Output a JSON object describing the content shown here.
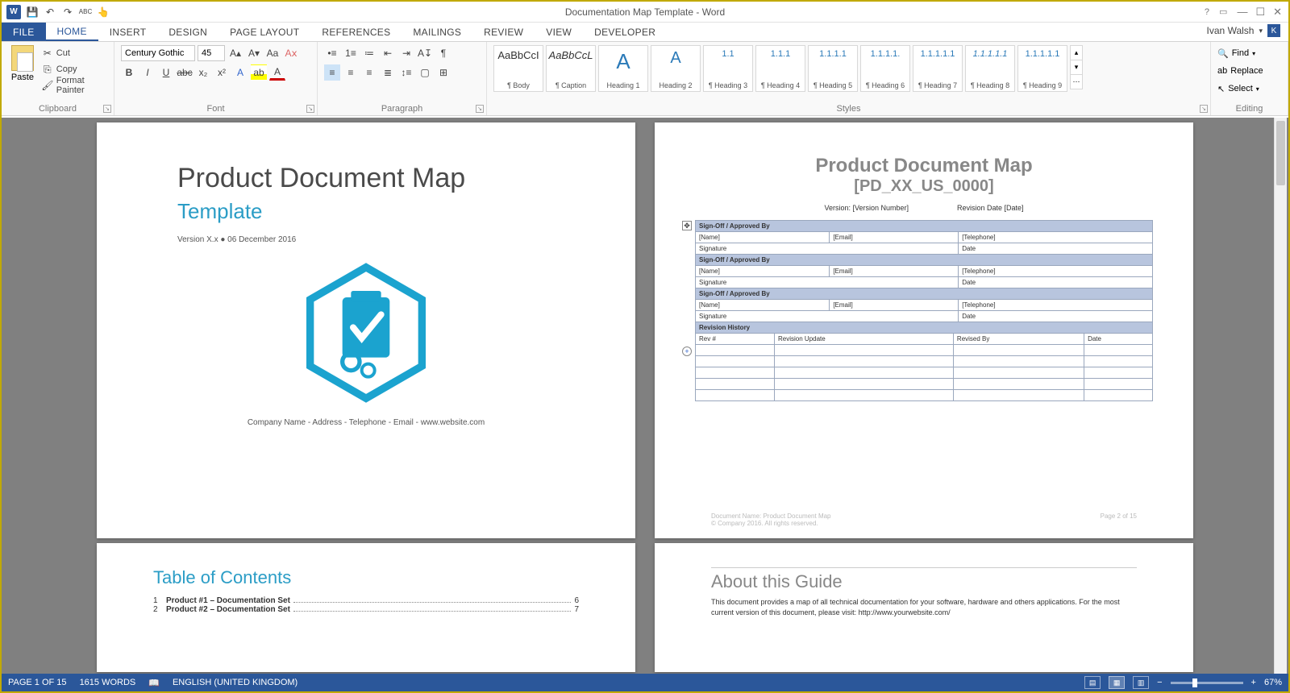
{
  "app": {
    "title": "Documentation Map Template - Word",
    "user": "Ivan Walsh",
    "user_initial": "K"
  },
  "qat": {
    "save": "💾",
    "undo": "↶",
    "redo": "↷",
    "spell": "ABC",
    "touch": "👆"
  },
  "tabs": [
    "FILE",
    "HOME",
    "INSERT",
    "DESIGN",
    "PAGE LAYOUT",
    "REFERENCES",
    "MAILINGS",
    "REVIEW",
    "VIEW",
    "DEVELOPER"
  ],
  "clipboard": {
    "paste": "Paste",
    "cut": "Cut",
    "copy": "Copy",
    "painter": "Format Painter",
    "group": "Clipboard"
  },
  "font": {
    "name": "Century Gothic",
    "size": "45",
    "group": "Font"
  },
  "paragraph": {
    "group": "Paragraph"
  },
  "styles_group": "Styles",
  "styles": [
    {
      "preview": "AaBbCcI",
      "label": "¶ Body"
    },
    {
      "preview": "AaBbCcL",
      "label": "¶ Caption"
    },
    {
      "preview": "A",
      "label": "Heading 1"
    },
    {
      "preview": "A",
      "label": "Heading 2"
    },
    {
      "preview": "1.1",
      "label": "¶ Heading 3"
    },
    {
      "preview": "1.1.1",
      "label": "¶ Heading 4"
    },
    {
      "preview": "1.1.1.1",
      "label": "¶ Heading 5"
    },
    {
      "preview": "1.1.1.1.",
      "label": "¶ Heading 6"
    },
    {
      "preview": "1.1.1.1.1",
      "label": "¶ Heading 7"
    },
    {
      "preview": "1.1.1.1.1",
      "label": "¶ Heading 8"
    },
    {
      "preview": "1.1.1.1.1",
      "label": "¶ Heading 9"
    }
  ],
  "editing": {
    "find": "Find",
    "replace": "Replace",
    "select": "Select",
    "group": "Editing"
  },
  "page1": {
    "title": "Product Document Map",
    "subtitle": "Template",
    "version": "Version X.x ● 06 December 2016",
    "footer": "Company Name - Address - Telephone - Email - www.website.com"
  },
  "page2": {
    "title": "Product Document Map",
    "code": "[PD_XX_US_0000]",
    "version_label": "Version: [Version Number]",
    "revdate_label": "Revision Date [Date]",
    "signoff_hdr": "Sign-Off / Approved By",
    "name": "[Name]",
    "email": "[Email]",
    "tel": "[Telephone]",
    "signature": "Signature",
    "date": "Date",
    "revhist": "Revision History",
    "rev_cols": [
      "Rev #",
      "Revision Update",
      "Revised By",
      "Date"
    ],
    "footer_left1": "Document Name: Product Document Map",
    "footer_left2": "© Company 2016. All rights reserved.",
    "footer_right": "Page 2 of 15"
  },
  "page3": {
    "title": "Table of Contents",
    "items": [
      {
        "n": "1",
        "t": "Product #1 – Documentation Set",
        "p": "6"
      },
      {
        "n": "2",
        "t": "Product #2 – Documentation Set",
        "p": "7"
      }
    ]
  },
  "page4": {
    "title": "About this Guide",
    "text": "This document provides a map of all technical documentation for your software, hardware and others applications. For the most current version of this document, please visit: http://www.yourwebsite.com/"
  },
  "status": {
    "page": "PAGE 1 OF 15",
    "words": "1615 WORDS",
    "lang": "ENGLISH (UNITED KINGDOM)",
    "zoom": "67%"
  }
}
